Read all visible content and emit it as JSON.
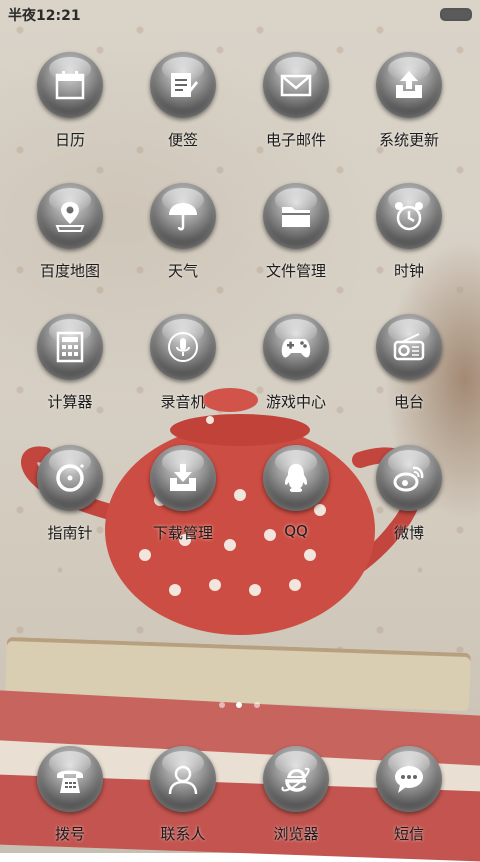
{
  "status_bar": {
    "time": "半夜12:21"
  },
  "apps": [
    {
      "label": "日历",
      "icon": "calendar-icon"
    },
    {
      "label": "便签",
      "icon": "notepad-icon"
    },
    {
      "label": "电子邮件",
      "icon": "mail-icon"
    },
    {
      "label": "系统更新",
      "icon": "system-update-icon"
    },
    {
      "label": "百度地图",
      "icon": "map-icon"
    },
    {
      "label": "天气",
      "icon": "umbrella-icon"
    },
    {
      "label": "文件管理",
      "icon": "folder-icon"
    },
    {
      "label": "时钟",
      "icon": "alarm-clock-icon"
    },
    {
      "label": "计算器",
      "icon": "calculator-icon"
    },
    {
      "label": "录音机",
      "icon": "microphone-icon"
    },
    {
      "label": "游戏中心",
      "icon": "gamepad-icon"
    },
    {
      "label": "电台",
      "icon": "radio-icon"
    },
    {
      "label": "指南针",
      "icon": "compass-icon"
    },
    {
      "label": "下载管理",
      "icon": "download-icon"
    },
    {
      "label": "QQ",
      "icon": "qq-penguin-icon"
    },
    {
      "label": "微博",
      "icon": "weibo-icon"
    }
  ],
  "dock": [
    {
      "label": "拨号",
      "icon": "telephone-icon"
    },
    {
      "label": "联系人",
      "icon": "contact-person-icon"
    },
    {
      "label": "浏览器",
      "icon": "browser-e-icon"
    },
    {
      "label": "短信",
      "icon": "message-bubble-icon"
    }
  ],
  "pager": {
    "pages": 3,
    "current": 2
  }
}
